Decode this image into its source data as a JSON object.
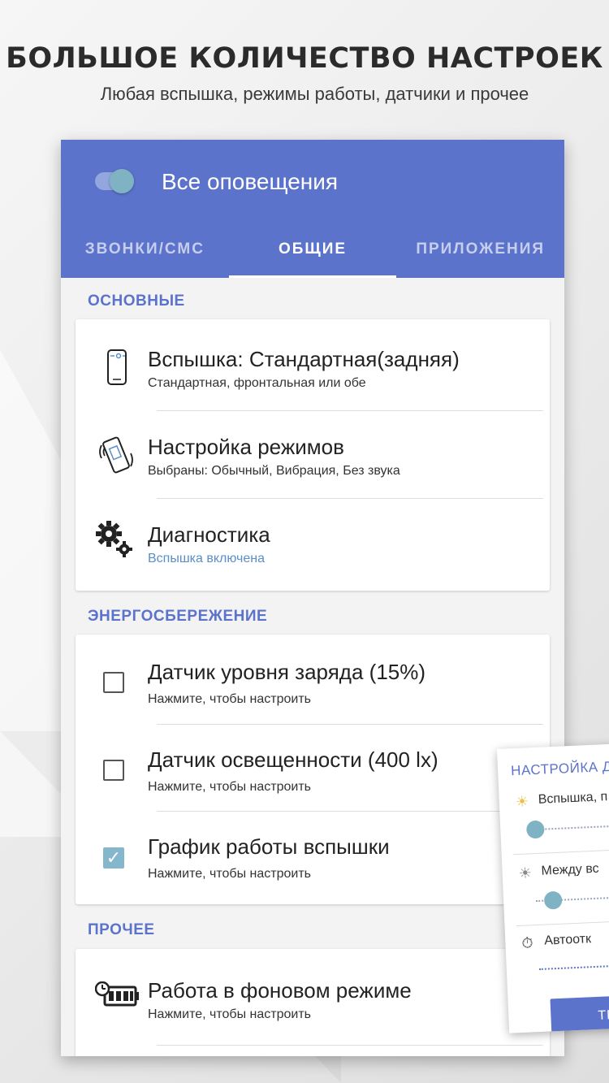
{
  "promo": {
    "headline": "БОЛЬШОЕ КОЛИЧЕСТВО НАСТРОЕК",
    "subheadline": "Любая вспышка, режимы работы, датчики и прочее"
  },
  "appbar": {
    "title": "Все оповещения",
    "master_switch_on": true,
    "tabs": [
      {
        "label": "ЗВОНКИ/СМС",
        "active": false
      },
      {
        "label": "ОБЩИЕ",
        "active": true
      },
      {
        "label": "ПРИЛОЖЕНИЯ",
        "active": false
      }
    ]
  },
  "sections": {
    "main": {
      "label": "ОСНОВНЫЕ",
      "items": [
        {
          "title": "Вспышка: Стандартная(задняя)",
          "subtitle": "Стандартная, фронтальная или обе",
          "icon": "phone-flash-icon"
        },
        {
          "title": "Настройка режимов",
          "subtitle": "Выбраны: Обычный, Вибрация, Без звука",
          "icon": "vibrating-phone-icon"
        },
        {
          "title": "Диагностика",
          "subtitle": "Вспышка включена",
          "icon": "gears-icon"
        }
      ]
    },
    "power": {
      "label": "ЭНЕРГОСБЕРЕЖЕНИЕ",
      "items": [
        {
          "title": "Датчик уровня заряда (15%)",
          "subtitle": "Нажмите, чтобы настроить",
          "checked": false
        },
        {
          "title": "Датчик освещенности (400 lx)",
          "subtitle": "Нажмите, чтобы настроить",
          "checked": false
        },
        {
          "title": "График работы вспышки",
          "subtitle": "Нажмите, чтобы настроить",
          "checked": true
        }
      ]
    },
    "other": {
      "label": "ПРОЧЕЕ",
      "items": [
        {
          "title": "Работа в фоновом режиме",
          "subtitle": "Нажмите, чтобы настроить",
          "icon": "battery-timer-icon"
        }
      ]
    }
  },
  "popup": {
    "title": "НАСТРОЙКА ДА",
    "rows": [
      {
        "label": "Вспышка, п",
        "icon": "sun-icon"
      },
      {
        "label": "Между вс",
        "icon": "dim-sun-icon"
      },
      {
        "label": "Автоотк",
        "icon": "timer-icon"
      }
    ],
    "button_label": "ТЕС"
  },
  "colors": {
    "primary": "#5c73cc",
    "accent": "#84b6cc",
    "link": "#5a8fc7"
  }
}
